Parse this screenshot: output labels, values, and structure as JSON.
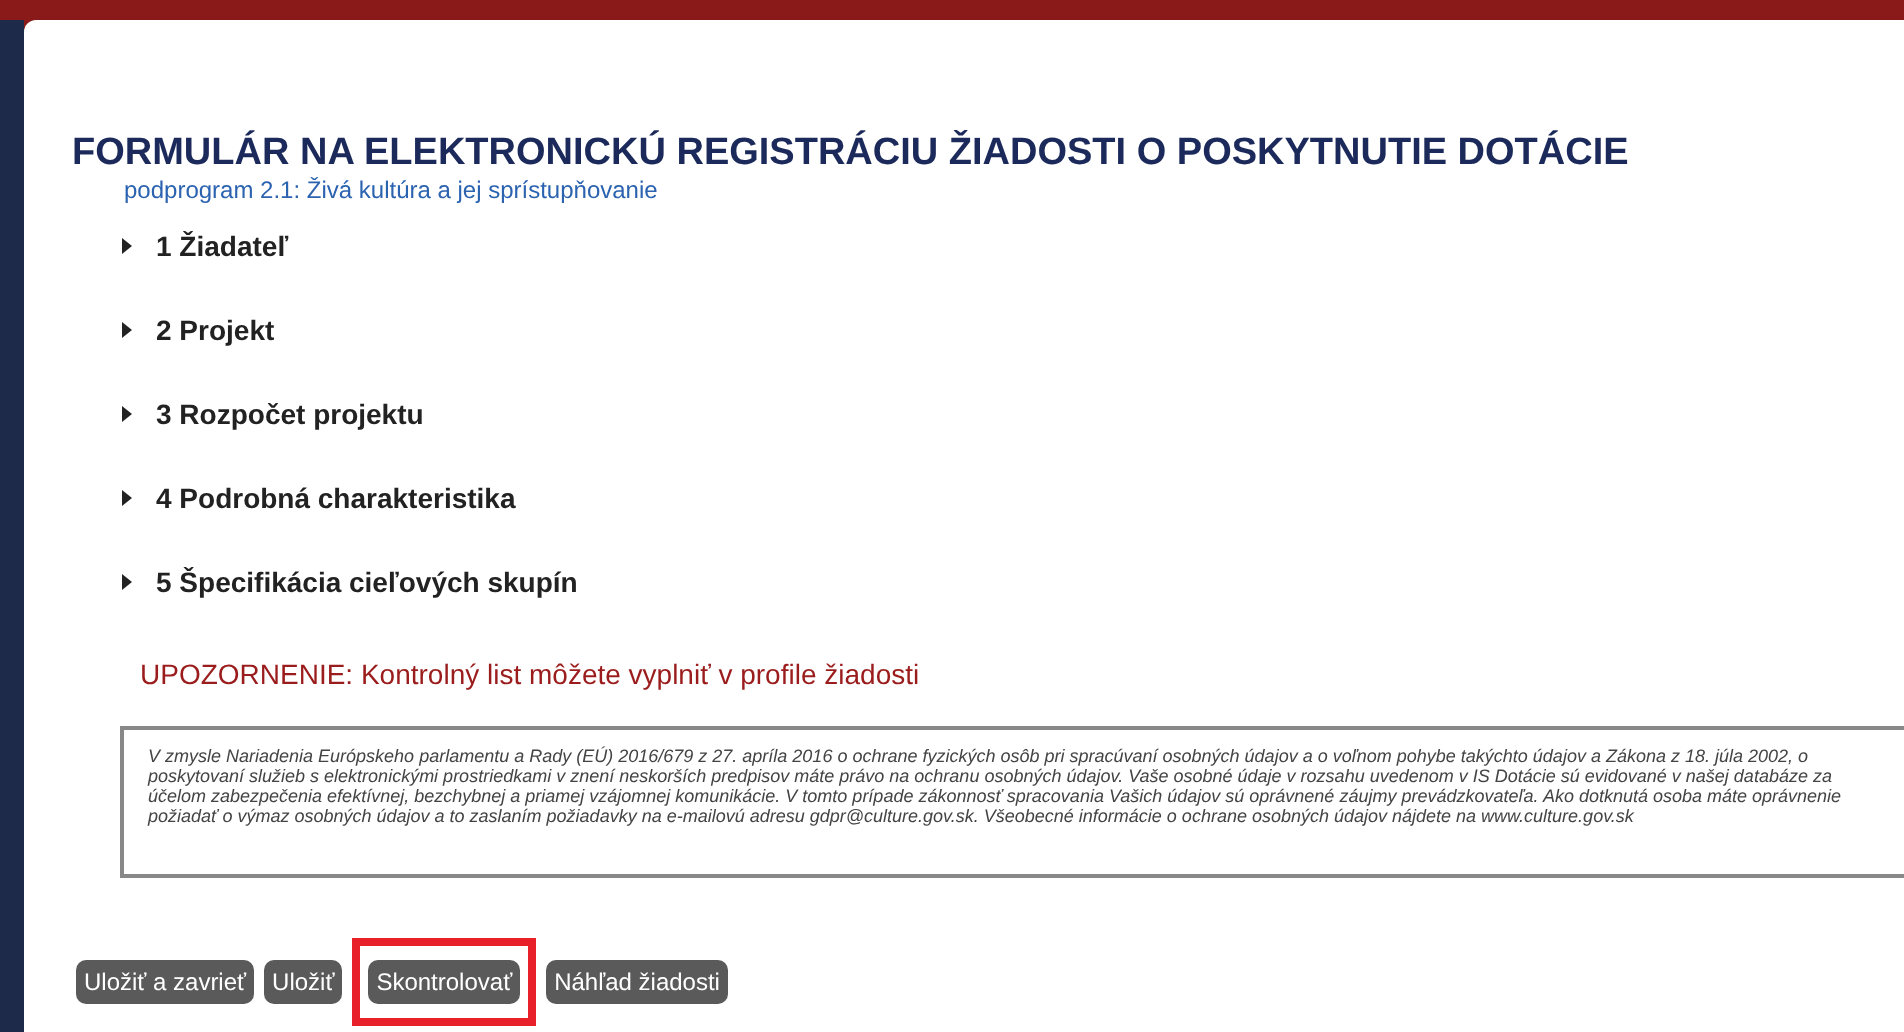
{
  "title": "FORMULÁR NA ELEKTRONICKÚ REGISTRÁCIU ŽIADOSTI O POSKYTNUTIE DOTÁCIE",
  "subtitle": "podprogram 2.1: Živá kultúra a jej sprístupňovanie",
  "sections": [
    {
      "label": "1 Žiadateľ",
      "expanded": false
    },
    {
      "label": "2 Projekt",
      "expanded": false
    },
    {
      "label": "3 Rozpočet projektu",
      "expanded": false
    },
    {
      "label": "4 Podrobná charakteristika",
      "expanded": false
    },
    {
      "label": "5 Špecifikácia cieľových skupín",
      "expanded": false
    }
  ],
  "warning": "UPOZORNENIE: Kontrolný list môžete vyplniť v profile žiadosti",
  "privacy_notice": "V zmysle Nariadenia Európskeho parlamentu a Rady (EÚ) 2016/679 z 27. apríla 2016 o ochrane fyzických osôb pri spracúvaní osobných údajov a o voľnom pohybe takýchto údajov a Zákona z 18. júla 2002, o poskytovaní služieb s elektronickými prostriedkami v znení neskorších predpisov máte právo na ochranu osobných údajov. Vaše osobné údaje v rozsahu uvedenom v IS Dotácie sú evidované v našej databáze za účelom zabezpečenia efektívnej, bezchybnej a priamej vzájomnej komunikácie. V tomto prípade zákonnosť spracovania Vašich údajov sú oprávnené záujmy prevádzkovateľa. Ako dotknutá osoba máte oprávnenie požiadať o výmaz osobných údajov a to zaslaním požiadavky na e-mailovú adresu gdpr@culture.gov.sk. Všeobecné informácie o ochrane osobných údajov nájdete na www.culture.gov.sk",
  "buttons": [
    {
      "label": "Uložiť a zavrieť",
      "highlighted": false
    },
    {
      "label": "Uložiť",
      "highlighted": false
    },
    {
      "label": "Skontrolovať",
      "highlighted": true
    },
    {
      "label": "Náhľad žiadosti",
      "highlighted": false
    }
  ]
}
